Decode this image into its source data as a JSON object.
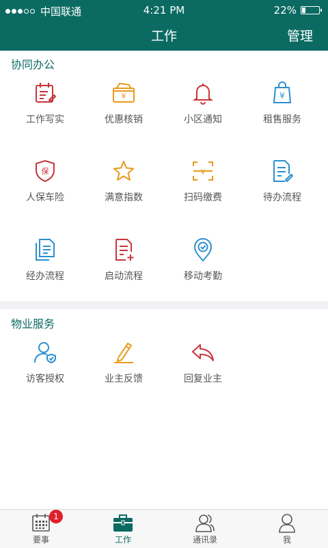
{
  "status_bar": {
    "carrier": "中国联通",
    "time": "4:21 PM",
    "battery_text": "22%",
    "battery_level": 0.22
  },
  "nav": {
    "title": "工作",
    "action": "管理"
  },
  "sections": {
    "office": {
      "title": "协同办公",
      "items": [
        {
          "label": "工作写实",
          "icon": "calendar-edit-icon",
          "color": "#c9343a"
        },
        {
          "label": "优惠核销",
          "icon": "coupon-wallet-icon",
          "color": "#e89a1c"
        },
        {
          "label": "小区通知",
          "icon": "bell-icon",
          "color": "#c9343a"
        },
        {
          "label": "租售服务",
          "icon": "shopping-bag-yen-icon",
          "color": "#2b8fd0"
        },
        {
          "label": "人保车险",
          "icon": "insurance-shield-icon",
          "color": "#c9343a"
        },
        {
          "label": "满意指数",
          "icon": "star-icon",
          "color": "#e89a1c"
        },
        {
          "label": "扫码缴费",
          "icon": "scan-pay-icon",
          "color": "#e89a1c"
        },
        {
          "label": "待办流程",
          "icon": "document-edit-icon",
          "color": "#2b8fd0"
        },
        {
          "label": "经办流程",
          "icon": "documents-icon",
          "color": "#2b8fd0"
        },
        {
          "label": "启动流程",
          "icon": "document-add-icon",
          "color": "#c9343a"
        },
        {
          "label": "移动考勤",
          "icon": "location-check-icon",
          "color": "#2b8fd0"
        }
      ]
    },
    "property": {
      "title": "物业服务",
      "items": [
        {
          "label": "访客授权",
          "icon": "visitor-shield-icon",
          "color": "#2b8fd0"
        },
        {
          "label": "业主反馈",
          "icon": "pencil-icon",
          "color": "#e89a1c"
        },
        {
          "label": "回复业主",
          "icon": "reply-icon",
          "color": "#c9343a"
        }
      ]
    }
  },
  "tabbar": {
    "items": [
      {
        "label": "要事",
        "icon": "calendar-grid-icon",
        "badge": "1"
      },
      {
        "label": "工作",
        "icon": "briefcase-icon",
        "active": true
      },
      {
        "label": "通讯录",
        "icon": "contacts-icon"
      },
      {
        "label": "我",
        "icon": "person-icon"
      }
    ]
  },
  "colors": {
    "primary": "#0b6b63",
    "red": "#c9343a",
    "orange": "#e89a1c",
    "blue": "#2b8fd0",
    "badge": "#e0202b"
  }
}
